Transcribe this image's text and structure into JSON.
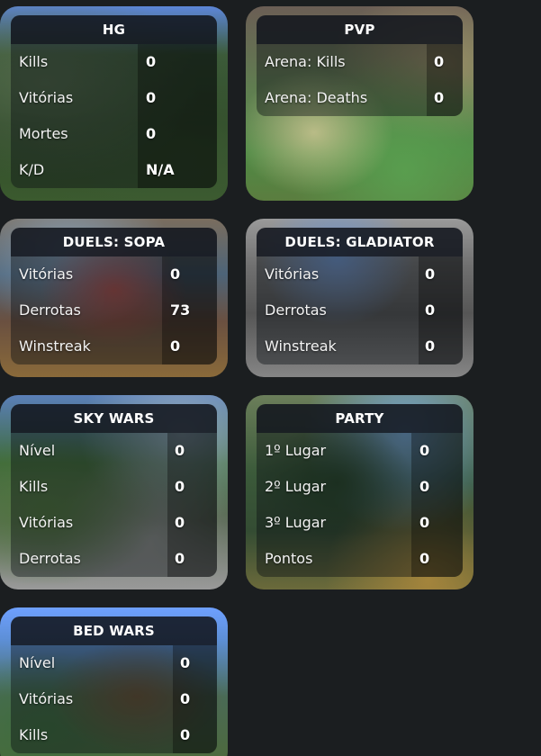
{
  "cards": {
    "hg": {
      "title": "HG",
      "rows": [
        {
          "label": "Kills",
          "value": "0"
        },
        {
          "label": "Vitórias",
          "value": "0"
        },
        {
          "label": "Mortes",
          "value": "0"
        },
        {
          "label": "K/D",
          "value": "N/A"
        }
      ]
    },
    "pvp": {
      "title": "PVP",
      "rows": [
        {
          "label": "Arena: Kills",
          "value": "0"
        },
        {
          "label": "Arena: Deaths",
          "value": "0"
        }
      ]
    },
    "duels_sopa": {
      "title": "DUELS: SOPA",
      "rows": [
        {
          "label": "Vitórias",
          "value": "0"
        },
        {
          "label": "Derrotas",
          "value": "73"
        },
        {
          "label": "Winstreak",
          "value": "0"
        }
      ]
    },
    "duels_gladiator": {
      "title": "DUELS: GLADIATOR",
      "rows": [
        {
          "label": "Vitórias",
          "value": "0"
        },
        {
          "label": "Derrotas",
          "value": "0"
        },
        {
          "label": "Winstreak",
          "value": "0"
        }
      ]
    },
    "sky_wars": {
      "title": "SKY WARS",
      "rows": [
        {
          "label": "Nível",
          "value": "0"
        },
        {
          "label": "Kills",
          "value": "0"
        },
        {
          "label": "Vitórias",
          "value": "0"
        },
        {
          "label": "Derrotas",
          "value": "0"
        }
      ]
    },
    "party": {
      "title": "PARTY",
      "rows": [
        {
          "label": "1º Lugar",
          "value": "0"
        },
        {
          "label": "2º Lugar",
          "value": "0"
        },
        {
          "label": "3º Lugar",
          "value": "0"
        },
        {
          "label": "Pontos",
          "value": "0"
        }
      ]
    },
    "bed_wars": {
      "title": "BED WARS",
      "rows": [
        {
          "label": "Nível",
          "value": "0"
        },
        {
          "label": "Vitórias",
          "value": "0"
        },
        {
          "label": "Kills",
          "value": "0"
        }
      ]
    }
  }
}
